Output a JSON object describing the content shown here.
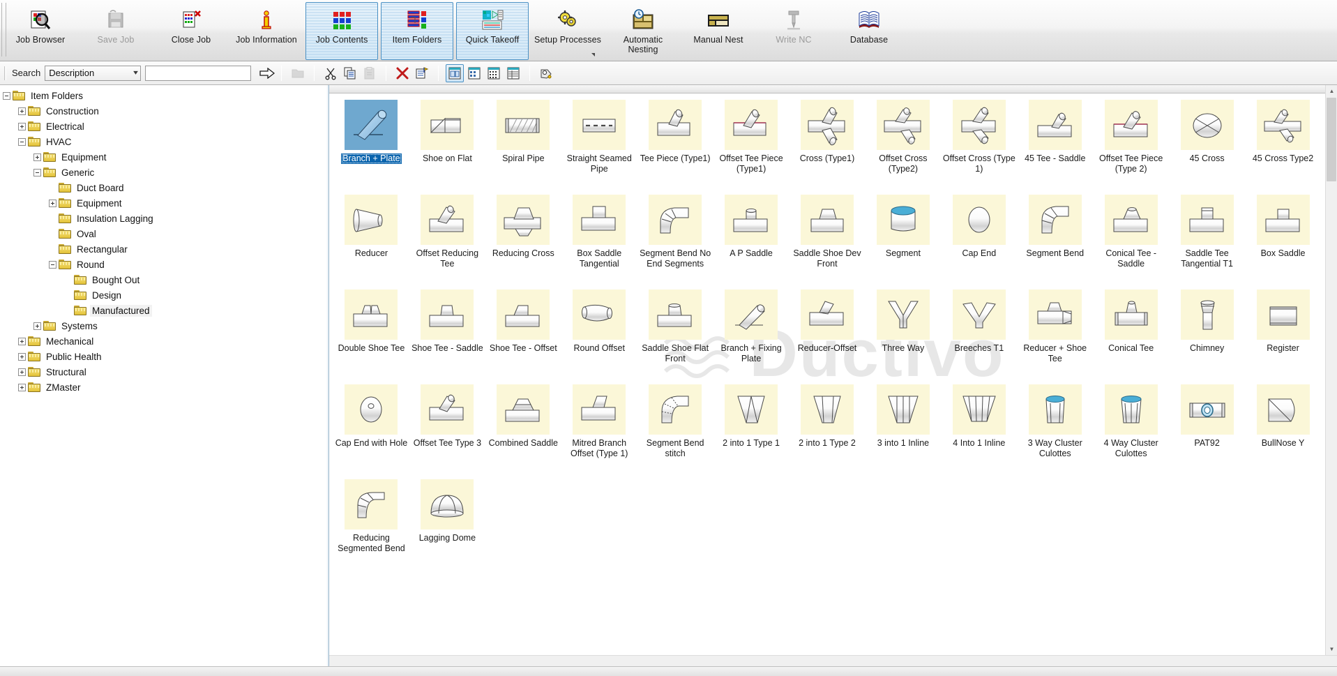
{
  "window": {
    "title": "Item Folders"
  },
  "ribbon": {
    "buttons": [
      {
        "label": "Job Browser",
        "icon": "job-browser-icon",
        "state": "normal"
      },
      {
        "label": "Save Job",
        "icon": "save-icon",
        "state": "disabled"
      },
      {
        "label": "Close Job",
        "icon": "close-job-icon",
        "state": "normal"
      },
      {
        "label": "Job Information",
        "icon": "info-icon",
        "state": "normal"
      },
      {
        "label": "Job Contents",
        "icon": "grid-blocks-icon",
        "state": "active"
      },
      {
        "label": "Item Folders",
        "icon": "item-folders-icon",
        "state": "active"
      },
      {
        "label": "Quick Takeoff",
        "icon": "quick-takeoff-icon",
        "state": "active"
      },
      {
        "label": "Setup Processes",
        "icon": "gears-icon",
        "state": "normal",
        "dropdown": true
      },
      {
        "label": "Automatic Nesting",
        "icon": "auto-nesting-icon",
        "state": "normal"
      },
      {
        "label": "Manual Nest",
        "icon": "manual-nest-icon",
        "state": "normal"
      },
      {
        "label": "Write NC",
        "icon": "write-nc-icon",
        "state": "disabled"
      },
      {
        "label": "Database",
        "icon": "database-book-icon",
        "state": "normal"
      }
    ]
  },
  "toolstrip": {
    "search_label": "Search",
    "field_selector": {
      "value": "Description",
      "icon": "chevron-down-icon"
    },
    "search_value": "",
    "search_placeholder": "",
    "go_icon": "arrow-right-icon",
    "buttons": [
      {
        "icon": "open-folder-icon",
        "state": "disabled"
      },
      {
        "icon": "cut-scissors-icon",
        "state": "normal"
      },
      {
        "icon": "copy-icon",
        "state": "normal"
      },
      {
        "icon": "paste-icon",
        "state": "disabled"
      },
      {
        "icon": "delete-x-icon",
        "state": "normal"
      },
      {
        "icon": "properties-icon",
        "state": "normal"
      },
      {
        "icon": "view-large-icons-icon",
        "state": "active"
      },
      {
        "icon": "view-small-icons-icon",
        "state": "normal"
      },
      {
        "icon": "view-list-icon",
        "state": "normal"
      },
      {
        "icon": "view-details-icon",
        "state": "normal"
      },
      {
        "icon": "tag-icon",
        "state": "normal"
      }
    ]
  },
  "tree": {
    "nodes": [
      {
        "label": "Item Folders",
        "depth": 0,
        "toggle": "minus",
        "highlight": false
      },
      {
        "label": "Construction",
        "depth": 1,
        "toggle": "plus",
        "highlight": false
      },
      {
        "label": "Electrical",
        "depth": 1,
        "toggle": "plus",
        "highlight": false
      },
      {
        "label": "HVAC",
        "depth": 1,
        "toggle": "minus",
        "highlight": false
      },
      {
        "label": "Equipment",
        "depth": 2,
        "toggle": "plus",
        "highlight": false
      },
      {
        "label": "Generic",
        "depth": 2,
        "toggle": "minus",
        "highlight": false
      },
      {
        "label": "Duct Board",
        "depth": 3,
        "toggle": "none",
        "highlight": false
      },
      {
        "label": "Equipment",
        "depth": 3,
        "toggle": "plus",
        "highlight": false
      },
      {
        "label": "Insulation Lagging",
        "depth": 3,
        "toggle": "none",
        "highlight": false
      },
      {
        "label": "Oval",
        "depth": 3,
        "toggle": "none",
        "highlight": false
      },
      {
        "label": "Rectangular",
        "depth": 3,
        "toggle": "none",
        "highlight": false
      },
      {
        "label": "Round",
        "depth": 3,
        "toggle": "minus",
        "highlight": false
      },
      {
        "label": "Bought Out",
        "depth": 4,
        "toggle": "none",
        "highlight": false
      },
      {
        "label": "Design",
        "depth": 4,
        "toggle": "none",
        "highlight": false
      },
      {
        "label": "Manufactured",
        "depth": 4,
        "toggle": "none",
        "highlight": true
      },
      {
        "label": "Systems",
        "depth": 2,
        "toggle": "plus",
        "highlight": false
      },
      {
        "label": "Mechanical",
        "depth": 1,
        "toggle": "plus",
        "highlight": false
      },
      {
        "label": "Public Health",
        "depth": 1,
        "toggle": "plus",
        "highlight": false
      },
      {
        "label": "Structural",
        "depth": 1,
        "toggle": "plus",
        "highlight": false
      },
      {
        "label": "ZMaster",
        "depth": 1,
        "toggle": "plus",
        "highlight": false
      }
    ]
  },
  "watermark": {
    "text": "Ductivo",
    "icon": "waves-icon"
  },
  "grid": {
    "selected_index": 0,
    "items": [
      {
        "label": "Branch + Plate",
        "icon": "branch-plate-icon"
      },
      {
        "label": "Shoe on Flat",
        "icon": "shoe-on-flat-icon"
      },
      {
        "label": "Spiral Pipe",
        "icon": "spiral-pipe-icon"
      },
      {
        "label": "Straight Seamed Pipe",
        "icon": "straight-seamed-pipe-icon"
      },
      {
        "label": "Tee Piece (Type1)",
        "icon": "tee-piece-type1-icon"
      },
      {
        "label": "Offset Tee Piece (Type1)",
        "icon": "offset-tee-piece-type1-icon"
      },
      {
        "label": "Cross (Type1)",
        "icon": "cross-type1-icon"
      },
      {
        "label": "Offset Cross (Type2)",
        "icon": "offset-cross-type2-icon"
      },
      {
        "label": "Offset Cross (Type 1)",
        "icon": "offset-cross-type1-icon"
      },
      {
        "label": "45 Tee - Saddle",
        "icon": "45-tee-saddle-icon"
      },
      {
        "label": "Offset Tee Piece (Type 2)",
        "icon": "offset-tee-piece-type2-icon"
      },
      {
        "label": "45 Cross",
        "icon": "45-cross-icon"
      },
      {
        "label": "45 Cross Type2",
        "icon": "45-cross-type2-icon"
      },
      {
        "label": "Reducer",
        "icon": "reducer-icon"
      },
      {
        "label": "Offset Reducing Tee",
        "icon": "offset-reducing-tee-icon"
      },
      {
        "label": "Reducing Cross",
        "icon": "reducing-cross-icon"
      },
      {
        "label": "Box Saddle Tangential",
        "icon": "box-saddle-tangential-icon"
      },
      {
        "label": "Segment Bend No End Segments",
        "icon": "segment-bend-no-end-segments-icon"
      },
      {
        "label": "A P Saddle",
        "icon": "ap-saddle-icon"
      },
      {
        "label": "Saddle Shoe Dev Front",
        "icon": "saddle-shoe-dev-front-icon"
      },
      {
        "label": "Segment",
        "icon": "segment-icon"
      },
      {
        "label": "Cap End",
        "icon": "cap-end-icon"
      },
      {
        "label": "Segment Bend",
        "icon": "segment-bend-icon"
      },
      {
        "label": "Conical Tee - Saddle",
        "icon": "conical-tee-saddle-icon"
      },
      {
        "label": "Saddle Tee Tangential T1",
        "icon": "saddle-tee-tangential-t1-icon"
      },
      {
        "label": "Box Saddle",
        "icon": "box-saddle-icon"
      },
      {
        "label": "Double Shoe Tee",
        "icon": "double-shoe-tee-icon"
      },
      {
        "label": "Shoe Tee - Saddle",
        "icon": "shoe-tee-saddle-icon"
      },
      {
        "label": "Shoe Tee - Offset",
        "icon": "shoe-tee-offset-icon"
      },
      {
        "label": "Round Offset",
        "icon": "round-offset-icon"
      },
      {
        "label": "Saddle Shoe Flat Front",
        "icon": "saddle-shoe-flat-front-icon"
      },
      {
        "label": "Branch + Fixing Plate",
        "icon": "branch-fixing-plate-icon"
      },
      {
        "label": "Reducer-Offset",
        "icon": "reducer-offset-icon"
      },
      {
        "label": "Three Way",
        "icon": "three-way-icon"
      },
      {
        "label": "Breeches T1",
        "icon": "breeches-t1-icon"
      },
      {
        "label": "Reducer + Shoe Tee",
        "icon": "reducer-shoe-tee-icon"
      },
      {
        "label": "Conical Tee",
        "icon": "conical-tee-icon"
      },
      {
        "label": "Chimney",
        "icon": "chimney-icon"
      },
      {
        "label": "Register",
        "icon": "register-icon"
      },
      {
        "label": "Cap End with Hole",
        "icon": "cap-end-with-hole-icon"
      },
      {
        "label": "Offset Tee Type 3",
        "icon": "offset-tee-type3-icon"
      },
      {
        "label": "Combined Saddle",
        "icon": "combined-saddle-icon"
      },
      {
        "label": "Mitred Branch Offset (Type 1)",
        "icon": "mitred-branch-offset-type1-icon"
      },
      {
        "label": "Segment Bend stitch",
        "icon": "segment-bend-stitch-icon"
      },
      {
        "label": "2 into 1 Type 1",
        "icon": "2-into-1-type1-icon"
      },
      {
        "label": "2 into 1 Type 2",
        "icon": "2-into-1-type2-icon"
      },
      {
        "label": "3 into 1 Inline",
        "icon": "3-into-1-inline-icon"
      },
      {
        "label": "4 Into 1 Inline",
        "icon": "4-into-1-inline-icon"
      },
      {
        "label": "3 Way Cluster Culottes",
        "icon": "3-way-cluster-culottes-icon"
      },
      {
        "label": "4 Way Cluster Culottes",
        "icon": "4-way-cluster-culottes-icon"
      },
      {
        "label": "PAT92",
        "icon": "pat92-icon"
      },
      {
        "label": "BullNose Y",
        "icon": "bullnose-y-icon"
      },
      {
        "label": "Reducing Segmented Bend",
        "icon": "reducing-segmented-bend-icon"
      },
      {
        "label": "Lagging Dome",
        "icon": "lagging-dome-icon"
      }
    ]
  },
  "scrollbars": {
    "vertical": {
      "up_icon": "caret-up-icon",
      "down_icon": "caret-down-icon"
    },
    "horizontal": {
      "left_icon": "caret-left-icon",
      "right_icon": "caret-right-icon"
    }
  }
}
